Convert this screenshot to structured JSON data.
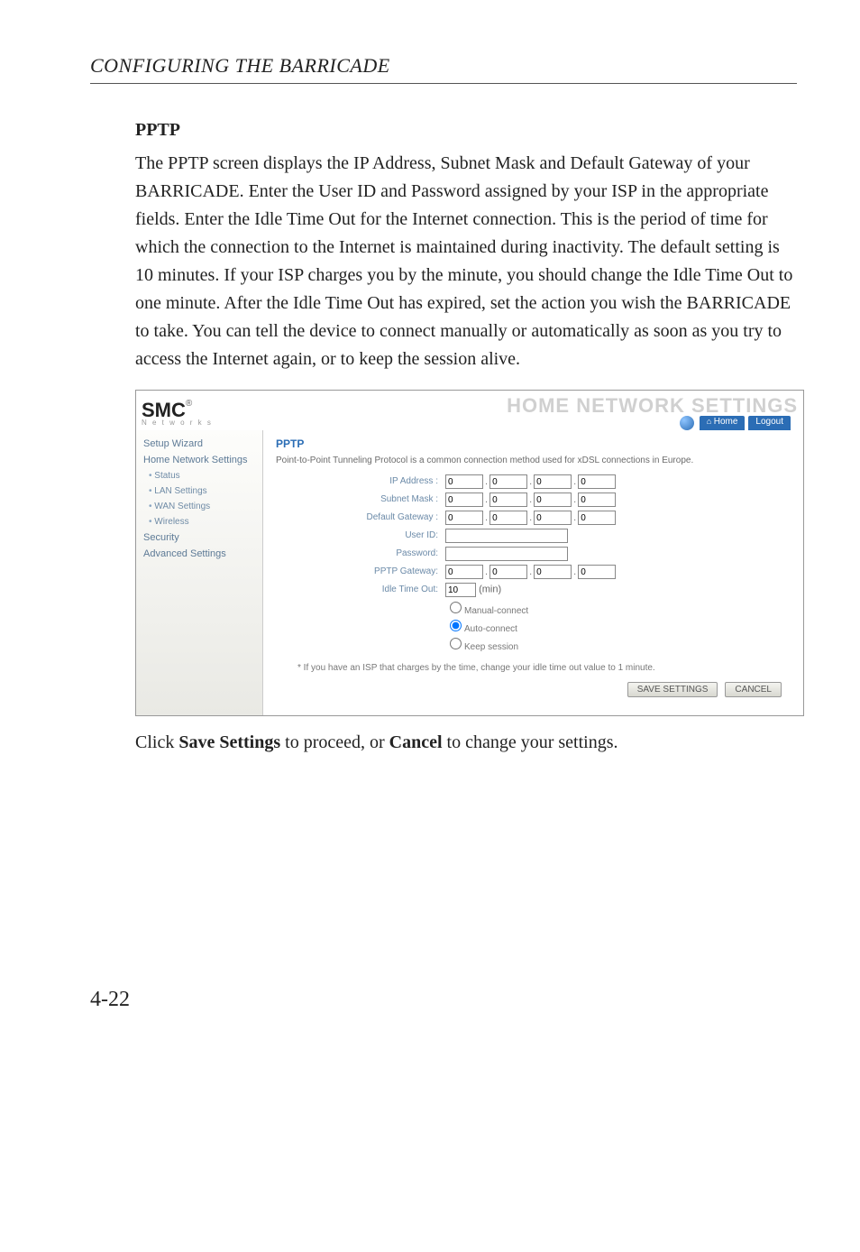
{
  "running_head": "CONFIGURING THE BARRICADE",
  "section_title": "PPTP",
  "body_paragraph": "The PPTP screen displays the IP Address, Subnet Mask and Default Gateway of your BARRICADE. Enter the User ID and Password assigned by your ISP in the appropriate fields. Enter the Idle Time Out for the Internet connection. This is the period of time for which the connection to the Internet is maintained during inactivity. The default setting is 10 minutes. If your ISP charges you by the minute, you should change the Idle Time Out to one minute. After the Idle Time Out has expired, set the action you wish the BARRICADE to take. You can tell the device to connect manually or automatically as soon as you try to access the Internet again, or to keep the session alive.",
  "closing_prefix": "Click ",
  "closing_bold1": "Save Settings",
  "closing_mid": " to proceed, or ",
  "closing_bold2": "Cancel",
  "closing_suffix": " to change your settings.",
  "page_number": "4-22",
  "screenshot": {
    "logo_main": "SMC",
    "logo_reg": "®",
    "logo_sub": "N e t w o r k s",
    "header_title": "HOME NETWORK SETTINGS",
    "tab_home": "Home",
    "tab_logout": "Logout",
    "sidebar": {
      "setup_wizard": "Setup Wizard",
      "home_network": "Home Network Settings",
      "status": "Status",
      "lan": "LAN Settings",
      "wan": "WAN Settings",
      "wireless": "Wireless",
      "security": "Security",
      "advanced": "Advanced Settings"
    },
    "main": {
      "title": "PPTP",
      "desc": "Point-to-Point Tunneling Protocol is a common connection method used for xDSL connections in Europe.",
      "labels": {
        "ip": "IP Address :",
        "subnet": "Subnet Mask :",
        "gateway": "Default Gateway :",
        "userid": "User ID:",
        "password": "Password:",
        "pptp_gw": "PPTP Gateway:",
        "idle": "Idle Time Out:"
      },
      "values": {
        "ip": [
          "0",
          "0",
          "0",
          "0"
        ],
        "subnet": [
          "0",
          "0",
          "0",
          "0"
        ],
        "gateway": [
          "0",
          "0",
          "0",
          "0"
        ],
        "pptp_gw": [
          "0",
          "0",
          "0",
          "0"
        ],
        "idle": "10",
        "idle_unit": "(min)"
      },
      "radios": {
        "manual": "Manual-connect",
        "auto": "Auto-connect",
        "keep": "Keep session"
      },
      "note": "* If you have an ISP that charges by the time, change your idle time out value to 1 minute.",
      "btn_save": "SAVE SETTINGS",
      "btn_cancel": "CANCEL"
    }
  }
}
